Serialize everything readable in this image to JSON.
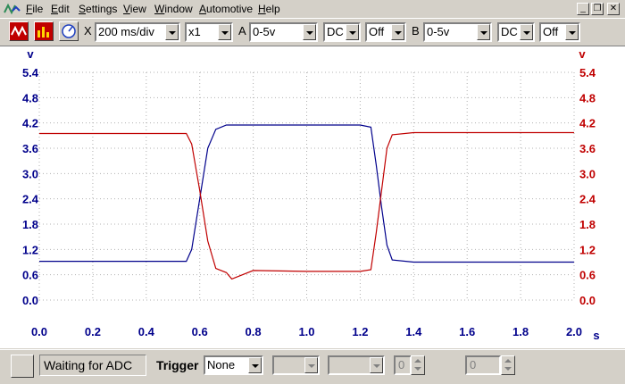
{
  "menu": {
    "items": [
      "File",
      "Edit",
      "Settings",
      "View",
      "Window",
      "Automotive",
      "Help"
    ]
  },
  "window_controls": {
    "minimize": "_",
    "restore": "❐",
    "close": "✕"
  },
  "toolbar": {
    "scope_button_icon": "scope-icon",
    "spectrum_button_icon": "spectrum-icon",
    "meter_button_icon": "meter-icon",
    "timebase_label": "X",
    "timebase_value": "200 ms/div",
    "multiplier_value": "x1",
    "channel_a_label": "A",
    "channel_a_range": "0-5v",
    "channel_a_coupling": "DC",
    "channel_a_option": "Off",
    "channel_b_label": "B",
    "channel_b_range": "0-5v",
    "channel_b_coupling": "DC",
    "channel_b_option": "Off"
  },
  "chart_data": {
    "type": "line",
    "xlabel": "s",
    "xlim": [
      0.0,
      2.0
    ],
    "x_ticks": [
      "0.0",
      "0.2",
      "0.4",
      "0.6",
      "0.8",
      "1.0",
      "1.2",
      "1.4",
      "1.6",
      "1.8",
      "2.0"
    ],
    "y_left_unit": "v",
    "y_right_unit": "v",
    "ylim": [
      0.0,
      5.4
    ],
    "y_ticks": [
      "0.0",
      "0.6",
      "1.2",
      "1.8",
      "2.4",
      "3.0",
      "3.6",
      "4.2",
      "4.8",
      "5.4"
    ],
    "grid": true,
    "colors": {
      "channel_a": "#00008b",
      "channel_b": "#c00000",
      "grid": "#b0b0b0"
    },
    "series": [
      {
        "color": "#00008b",
        "x": [
          0.0,
          0.2,
          0.4,
          0.55,
          0.57,
          0.6,
          0.63,
          0.66,
          0.7,
          0.8,
          1.0,
          1.2,
          1.24,
          1.26,
          1.28,
          1.3,
          1.32,
          1.4,
          1.6,
          1.8,
          2.0
        ],
        "y": [
          0.92,
          0.92,
          0.92,
          0.92,
          1.2,
          2.4,
          3.6,
          4.05,
          4.15,
          4.15,
          4.15,
          4.15,
          4.1,
          3.2,
          2.2,
          1.3,
          0.95,
          0.9,
          0.9,
          0.9,
          0.9
        ]
      },
      {
        "color": "#c00000",
        "x": [
          0.0,
          0.2,
          0.4,
          0.55,
          0.57,
          0.6,
          0.63,
          0.66,
          0.7,
          0.72,
          0.8,
          1.0,
          1.2,
          1.24,
          1.26,
          1.28,
          1.3,
          1.32,
          1.4,
          1.6,
          1.8,
          2.0
        ],
        "y": [
          3.95,
          3.95,
          3.95,
          3.95,
          3.7,
          2.6,
          1.4,
          0.75,
          0.65,
          0.5,
          0.7,
          0.68,
          0.68,
          0.72,
          1.6,
          2.6,
          3.6,
          3.92,
          3.97,
          3.97,
          3.97,
          3.97
        ]
      }
    ]
  },
  "statusbar": {
    "status_text": "Waiting for ADC",
    "trigger_label": "Trigger",
    "trigger_mode": "None",
    "trigger_value": "0",
    "delay_value": "0"
  }
}
